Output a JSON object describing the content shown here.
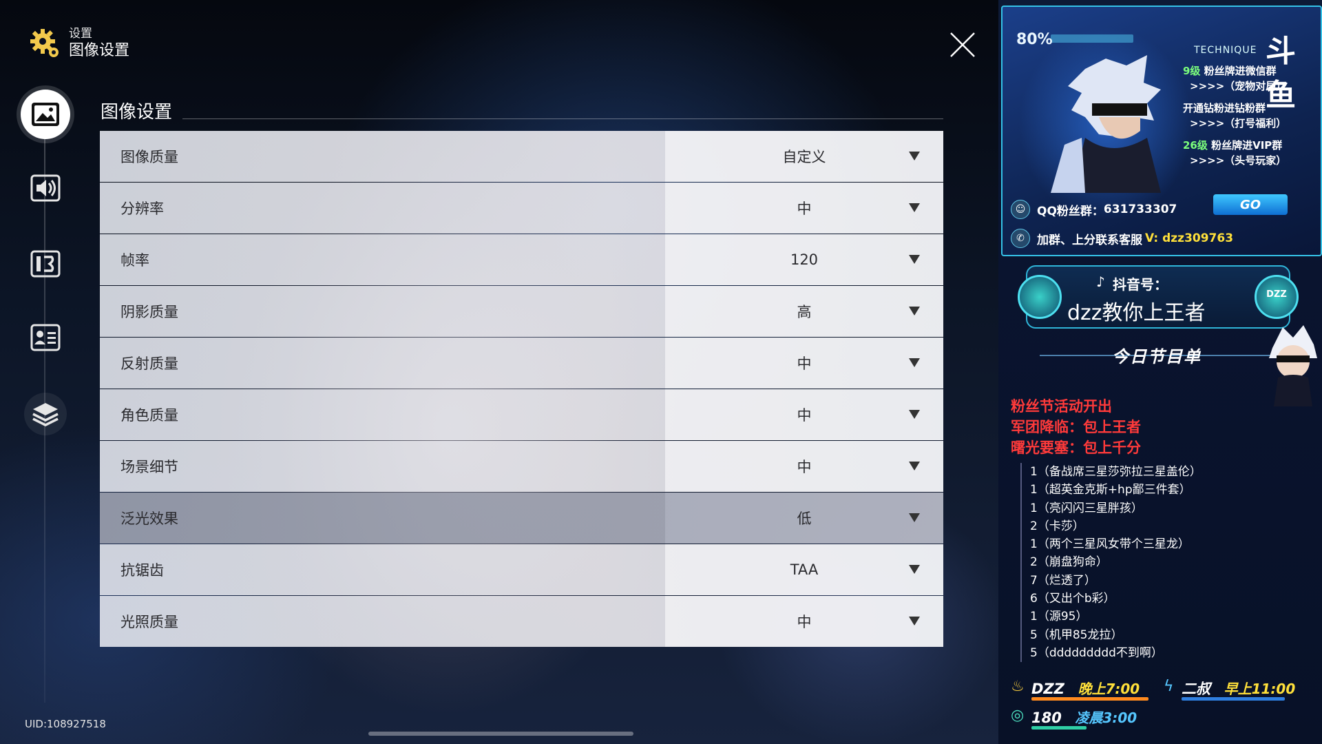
{
  "header": {
    "crumb_parent": "设置",
    "crumb_current": "图像设置"
  },
  "section_title": "图像设置",
  "settings": [
    {
      "label": "图像质量",
      "value": "自定义"
    },
    {
      "label": "分辨率",
      "value": "中"
    },
    {
      "label": "帧率",
      "value": "120"
    },
    {
      "label": "阴影质量",
      "value": "高"
    },
    {
      "label": "反射质量",
      "value": "中"
    },
    {
      "label": "角色质量",
      "value": "中"
    },
    {
      "label": "场景细节",
      "value": "中"
    },
    {
      "label": "泛光效果",
      "value": "低"
    },
    {
      "label": "抗锯齿",
      "value": "TAA"
    },
    {
      "label": "光照质量",
      "value": "中"
    }
  ],
  "uid": "UID:108927518",
  "overlay": {
    "progress": "80%",
    "technique": "TECHNIQUE",
    "logo": "斗鱼",
    "promo": [
      {
        "prefix": "9级",
        "text": " 粉丝牌进微信群",
        "sub": ">>>>（宠物对局）"
      },
      {
        "prefix": "开通",
        "text": "钻粉进钻粉群",
        "sub": ">>>>（打号福利）"
      },
      {
        "prefix": "26级",
        "text": " 粉丝牌进VIP群",
        "sub": ">>>>（头号玩家）"
      }
    ],
    "qq_label": "QQ粉丝群：",
    "qq_number": "631733307",
    "go": "GO",
    "wx_label": "加群、上分联系客服",
    "wx_id": "V: dzz309763",
    "douyin_label": "抖音号：",
    "douyin_name": "dzz教你上王者",
    "douyin_badge": "DZZ",
    "today_title": "今日节目单",
    "events": [
      "粉丝节活动开出",
      "军团降临：包上王者",
      "曙光要塞：包上千分"
    ],
    "program": [
      "1（备战席三星莎弥拉三星盖伦）",
      "1（超英金克斯+hp鄙三件套）",
      "1（亮闪闪三星胖孩）",
      "2（卡莎）",
      "1（两个三星风女带个三星龙）",
      "2（崩盘狗命）",
      "7（烂透了）",
      "6（又出个b彩）",
      "1（源95）",
      "5（机甲85龙拉）",
      "5（ddddddddd不到啊）"
    ],
    "schedule": [
      {
        "name": "DZZ",
        "time": "晚上7:00"
      },
      {
        "name": "二叔",
        "time": "早上11:00"
      },
      {
        "name": "180",
        "time": "凌晨3:00"
      }
    ]
  }
}
